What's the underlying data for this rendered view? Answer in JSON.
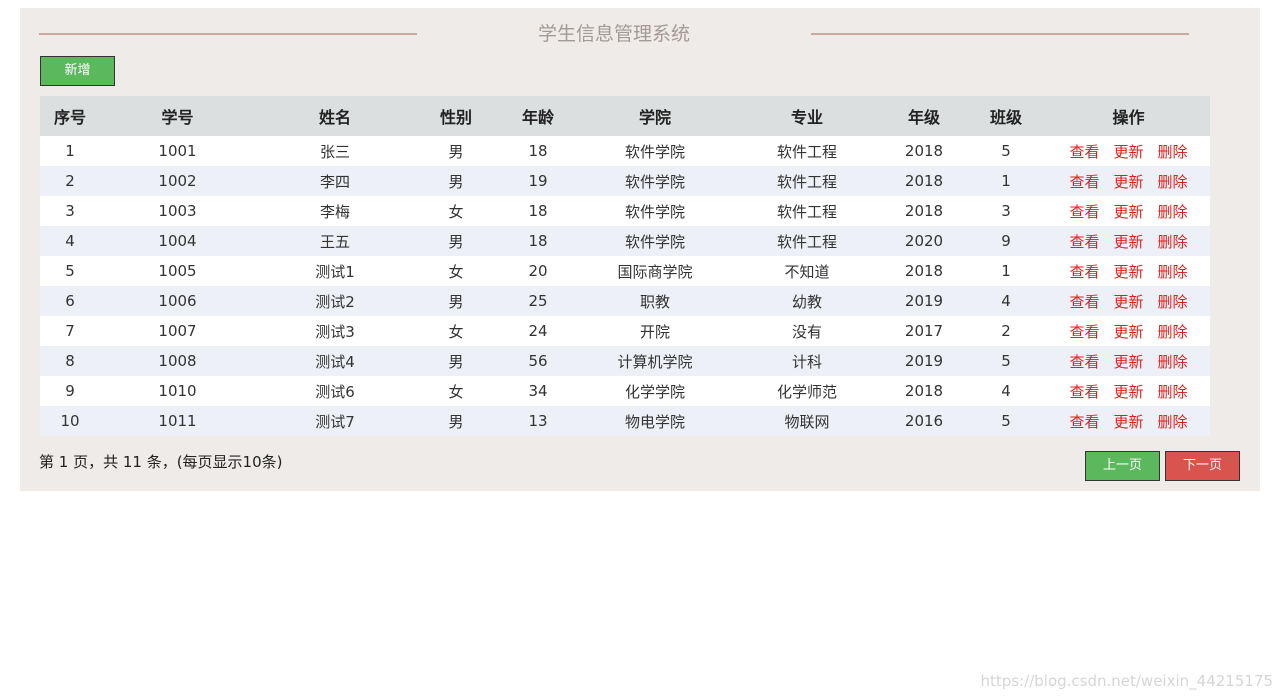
{
  "header": {
    "title": "学生信息管理系统"
  },
  "toolbar": {
    "add_label": "新增"
  },
  "table": {
    "columns": [
      "序号",
      "学号",
      "姓名",
      "性别",
      "年龄",
      "学院",
      "专业",
      "年级",
      "班级",
      "操作"
    ],
    "rows": [
      {
        "no": "1",
        "id": "1001",
        "name": "张三",
        "gender": "男",
        "age": "18",
        "college": "软件学院",
        "major": "软件工程",
        "grade": "2018",
        "class": "5"
      },
      {
        "no": "2",
        "id": "1002",
        "name": "李四",
        "gender": "男",
        "age": "19",
        "college": "软件学院",
        "major": "软件工程",
        "grade": "2018",
        "class": "1"
      },
      {
        "no": "3",
        "id": "1003",
        "name": "李梅",
        "gender": "女",
        "age": "18",
        "college": "软件学院",
        "major": "软件工程",
        "grade": "2018",
        "class": "3"
      },
      {
        "no": "4",
        "id": "1004",
        "name": "王五",
        "gender": "男",
        "age": "18",
        "college": "软件学院",
        "major": "软件工程",
        "grade": "2020",
        "class": "9"
      },
      {
        "no": "5",
        "id": "1005",
        "name": "测试1",
        "gender": "女",
        "age": "20",
        "college": "国际商学院",
        "major": "不知道",
        "grade": "2018",
        "class": "1"
      },
      {
        "no": "6",
        "id": "1006",
        "name": "测试2",
        "gender": "男",
        "age": "25",
        "college": "职教",
        "major": "幼教",
        "grade": "2019",
        "class": "4"
      },
      {
        "no": "7",
        "id": "1007",
        "name": "测试3",
        "gender": "女",
        "age": "24",
        "college": "开院",
        "major": "没有",
        "grade": "2017",
        "class": "2"
      },
      {
        "no": "8",
        "id": "1008",
        "name": "测试4",
        "gender": "男",
        "age": "56",
        "college": "计算机学院",
        "major": "计科",
        "grade": "2019",
        "class": "5"
      },
      {
        "no": "9",
        "id": "1010",
        "name": "测试6",
        "gender": "女",
        "age": "34",
        "college": "化学学院",
        "major": "化学师范",
        "grade": "2018",
        "class": "4"
      },
      {
        "no": "10",
        "id": "1011",
        "name": "测试7",
        "gender": "男",
        "age": "13",
        "college": "物电学院",
        "major": "物联网",
        "grade": "2016",
        "class": "5"
      }
    ],
    "actions": {
      "view": "查看",
      "update": "更新",
      "delete": "删除"
    }
  },
  "pagination": {
    "info": "第 1 页，共 11 条，(每页显示10条)",
    "prev_label": "上一页",
    "next_label": "下一页"
  },
  "watermark": "https://blog.csdn.net/weixin_44215175"
}
